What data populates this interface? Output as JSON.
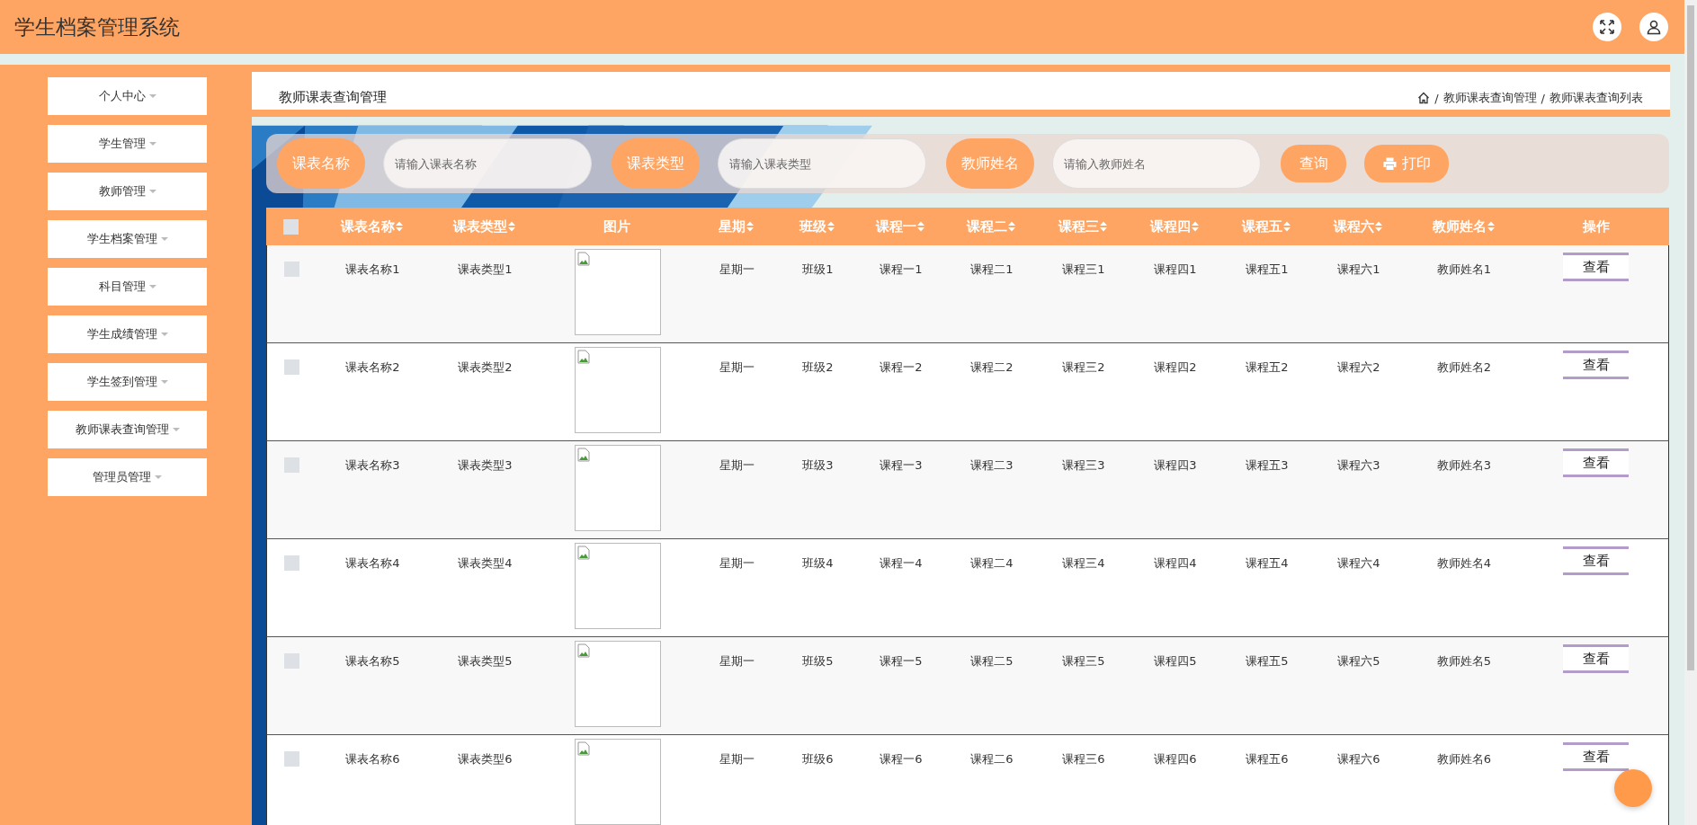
{
  "header": {
    "title": "学生档案管理系统"
  },
  "sidebar": {
    "items": [
      {
        "label": "个人中心"
      },
      {
        "label": "学生管理"
      },
      {
        "label": "教师管理"
      },
      {
        "label": "学生档案管理"
      },
      {
        "label": "科目管理"
      },
      {
        "label": "学生成绩管理"
      },
      {
        "label": "学生签到管理"
      },
      {
        "label": "教师课表查询管理"
      },
      {
        "label": "管理员管理"
      }
    ]
  },
  "page": {
    "title": "教师课表查询管理",
    "breadcrumb": [
      "教师课表查询管理",
      "教师课表查询列表"
    ],
    "separator": "/"
  },
  "search": {
    "fields": [
      {
        "label": "课表名称",
        "placeholder": "请输入课表名称"
      },
      {
        "label": "课表类型",
        "placeholder": "请输入课表类型"
      },
      {
        "label": "教师姓名",
        "placeholder": "请输入教师姓名"
      }
    ],
    "query_button": "查询",
    "print_button": "打印"
  },
  "table": {
    "columns": [
      {
        "label": "课表名称",
        "sortable": true
      },
      {
        "label": "课表类型",
        "sortable": true
      },
      {
        "label": "图片",
        "sortable": false
      },
      {
        "label": "星期",
        "sortable": true
      },
      {
        "label": "班级",
        "sortable": true
      },
      {
        "label": "课程一",
        "sortable": true
      },
      {
        "label": "课程二",
        "sortable": true
      },
      {
        "label": "课程三",
        "sortable": true
      },
      {
        "label": "课程四",
        "sortable": true
      },
      {
        "label": "课程五",
        "sortable": true
      },
      {
        "label": "课程六",
        "sortable": true
      },
      {
        "label": "教师姓名",
        "sortable": true
      },
      {
        "label": "操作",
        "sortable": false
      }
    ],
    "all_checked": false,
    "rows": [
      {
        "checked": false,
        "cells": [
          "课表名称1",
          "课表类型1",
          "",
          "星期一",
          "班级1",
          "课程一1",
          "课程二1",
          "课程三1",
          "课程四1",
          "课程五1",
          "课程六1",
          "教师姓名1"
        ],
        "action": "查看"
      },
      {
        "checked": false,
        "cells": [
          "课表名称2",
          "课表类型2",
          "",
          "星期一",
          "班级2",
          "课程一2",
          "课程二2",
          "课程三2",
          "课程四2",
          "课程五2",
          "课程六2",
          "教师姓名2"
        ],
        "action": "查看"
      },
      {
        "checked": false,
        "cells": [
          "课表名称3",
          "课表类型3",
          "",
          "星期一",
          "班级3",
          "课程一3",
          "课程二3",
          "课程三3",
          "课程四3",
          "课程五3",
          "课程六3",
          "教师姓名3"
        ],
        "action": "查看"
      },
      {
        "checked": false,
        "cells": [
          "课表名称4",
          "课表类型4",
          "",
          "星期一",
          "班级4",
          "课程一4",
          "课程二4",
          "课程三4",
          "课程四4",
          "课程五4",
          "课程六4",
          "教师姓名4"
        ],
        "action": "查看"
      },
      {
        "checked": false,
        "cells": [
          "课表名称5",
          "课表类型5",
          "",
          "星期一",
          "班级5",
          "课程一5",
          "课程二5",
          "课程三5",
          "课程四5",
          "课程五5",
          "课程六5",
          "教师姓名5"
        ],
        "action": "查看"
      },
      {
        "checked": false,
        "cells": [
          "课表名称6",
          "课表类型6",
          "",
          "星期一",
          "班级6",
          "课程一6",
          "课程二6",
          "课程三6",
          "课程四6",
          "课程五6",
          "课程六6",
          "教师姓名6"
        ],
        "action": "查看"
      }
    ]
  }
}
